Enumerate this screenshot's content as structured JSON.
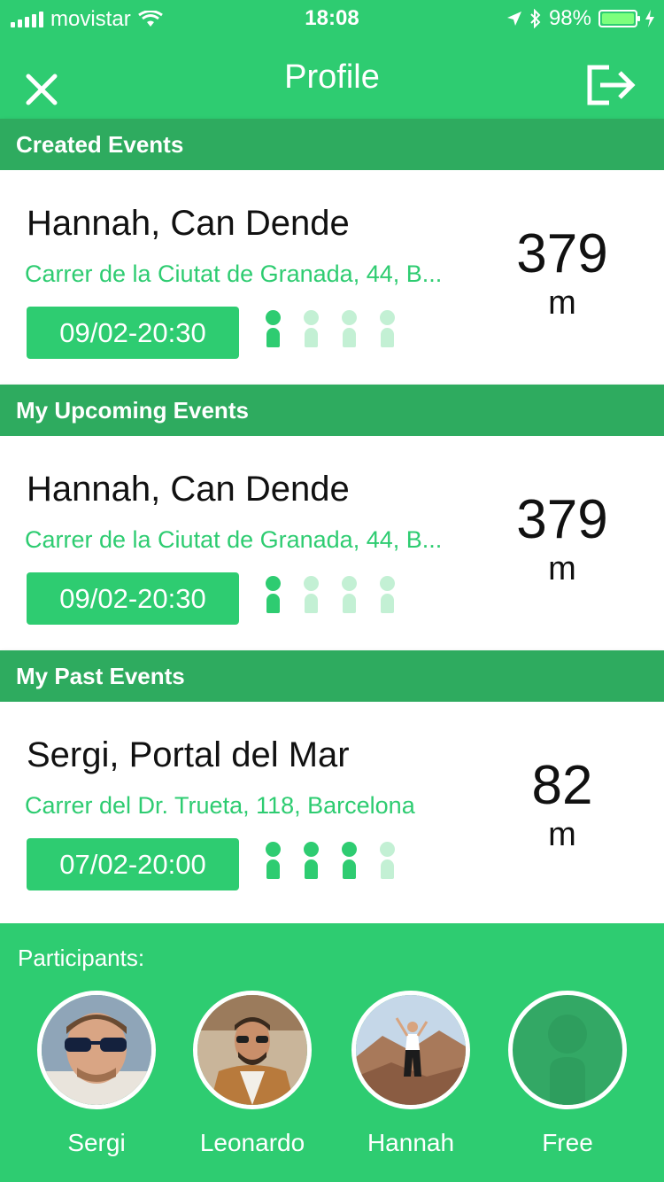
{
  "status": {
    "carrier": "movistar",
    "time": "18:08",
    "battery": "98%"
  },
  "nav": {
    "title": "Profile"
  },
  "sections": [
    {
      "header": "Created Events",
      "event": {
        "title": "Hannah, Can Dende",
        "address": "Carrer de la Ciutat de Granada, 44, B...",
        "date": "09/02-20:30",
        "distance": "379",
        "unit": "m",
        "filled": 1,
        "total": 4
      }
    },
    {
      "header": "My Upcoming Events",
      "event": {
        "title": "Hannah, Can Dende",
        "address": "Carrer de la Ciutat de Granada, 44, B...",
        "date": "09/02-20:30",
        "distance": "379",
        "unit": "m",
        "filled": 1,
        "total": 4
      }
    },
    {
      "header": "My Past Events",
      "event": {
        "title": "Sergi, Portal del Mar",
        "address": "Carrer del Dr. Trueta, 118, Barcelona",
        "date": "07/02-20:00",
        "distance": "82",
        "unit": "m",
        "filled": 3,
        "total": 4
      }
    }
  ],
  "participants": {
    "label": "Participants:",
    "people": [
      {
        "name": "Sergi",
        "avatar": "photo-man-sunglasses"
      },
      {
        "name": "Leonardo",
        "avatar": "photo-man-beard"
      },
      {
        "name": "Hannah",
        "avatar": "photo-woman-mountains"
      },
      {
        "name": "Free",
        "avatar": "empty-person-placeholder"
      }
    ]
  },
  "colors": {
    "primary": "#2ecc71",
    "header": "#2eab5f",
    "address": "#2ecc71"
  }
}
